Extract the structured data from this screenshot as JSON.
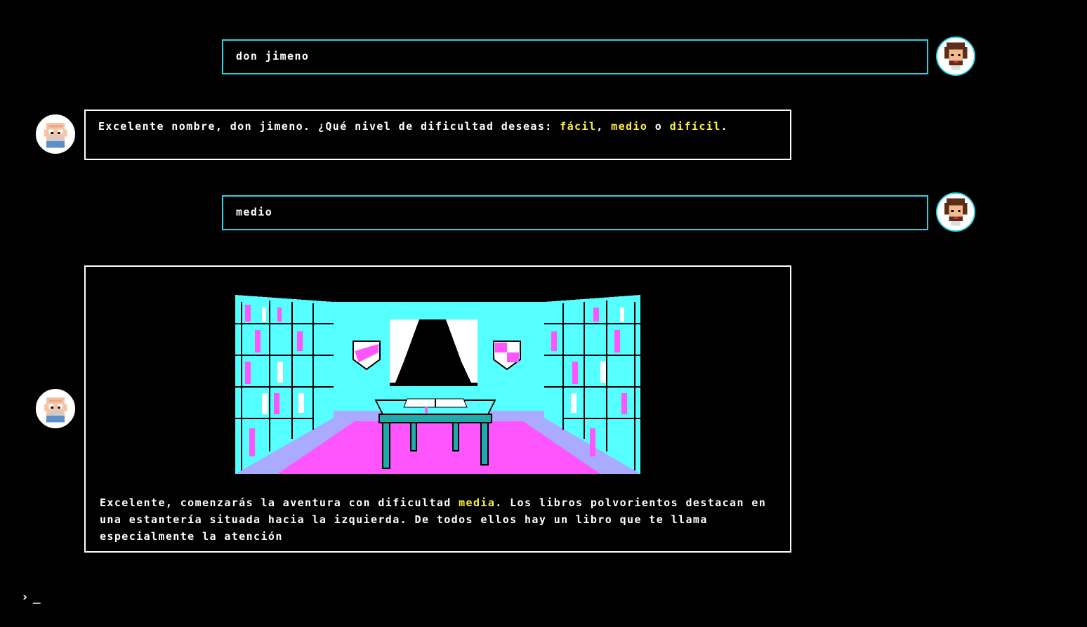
{
  "conversation": {
    "msg1": {
      "text": "don jimeno"
    },
    "msg2": {
      "intro": "Excelente nombre, don jimeno. ¿Qué nivel de dificultad deseas: ",
      "opt1": "fácil",
      "sep1": ", ",
      "opt2": "medio",
      "sep2": " o ",
      "opt3": "difícil",
      "end": "."
    },
    "msg3": {
      "text": "medio"
    },
    "msg4": {
      "pre": "Excelente, comenzarás la aventura con dificultad ",
      "level": "media",
      "post": ". Los libros polvorientos destacan en una estantería situada hacia la izquierda. De todos ellos hay un libro que te llama especialmente la atención"
    }
  },
  "prompt": {
    "symbol": "›",
    "cursor": "_"
  },
  "colors": {
    "user_border": "#29d2dc",
    "bot_border": "#ffffff",
    "highlight": "#fff23a",
    "scene_cyan": "#55ffff",
    "scene_magenta": "#ff55ff"
  },
  "icons": {
    "user_avatar": "pixel-bearded-man-avatar",
    "bot_avatar": "pixel-bald-old-man-avatar",
    "scene": "library-room-illustration"
  }
}
